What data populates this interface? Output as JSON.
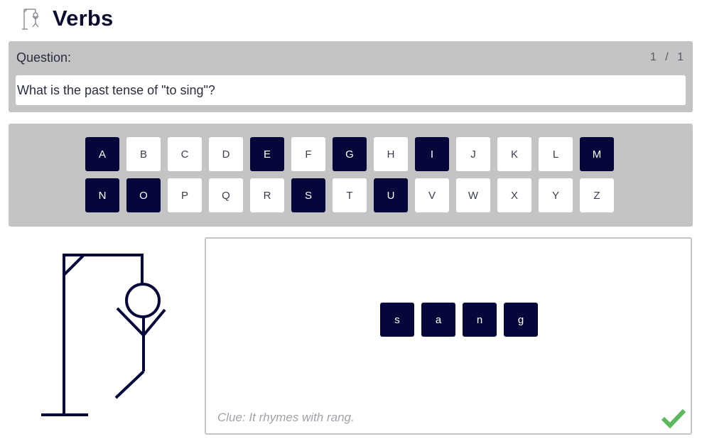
{
  "header": {
    "logo_icon": "hangman-icon",
    "title": "Verbs"
  },
  "question": {
    "label": "Question:",
    "counter": "1 / 1",
    "text": "What is the past tense of \"to sing\"?"
  },
  "letters": {
    "row1": [
      {
        "label": "A",
        "used": true
      },
      {
        "label": "B",
        "used": false
      },
      {
        "label": "C",
        "used": false
      },
      {
        "label": "D",
        "used": false
      },
      {
        "label": "E",
        "used": true
      },
      {
        "label": "F",
        "used": false
      },
      {
        "label": "G",
        "used": true
      },
      {
        "label": "H",
        "used": false
      },
      {
        "label": "I",
        "used": true
      },
      {
        "label": "J",
        "used": false
      },
      {
        "label": "K",
        "used": false
      },
      {
        "label": "L",
        "used": false
      },
      {
        "label": "M",
        "used": true
      }
    ],
    "row2": [
      {
        "label": "N",
        "used": true
      },
      {
        "label": "O",
        "used": true
      },
      {
        "label": "P",
        "used": false
      },
      {
        "label": "Q",
        "used": false
      },
      {
        "label": "R",
        "used": false
      },
      {
        "label": "S",
        "used": true
      },
      {
        "label": "T",
        "used": false
      },
      {
        "label": "U",
        "used": true
      },
      {
        "label": "V",
        "used": false
      },
      {
        "label": "W",
        "used": false
      },
      {
        "label": "X",
        "used": false
      },
      {
        "label": "Y",
        "used": false
      },
      {
        "label": "Z",
        "used": false
      }
    ]
  },
  "gallows": {
    "icon": "hangman-drawing"
  },
  "answer": {
    "letters": [
      "s",
      "a",
      "n",
      "g"
    ],
    "clue": "Clue: It rhymes with rang.",
    "status_icon": "check-icon",
    "status_color": "#5cb85c"
  },
  "colors": {
    "panel_bg": "#c4c4c4",
    "used_key_bg": "#05063a",
    "text": "#2a2d40",
    "title": "#0b0c30",
    "success": "#5cb85c"
  }
}
